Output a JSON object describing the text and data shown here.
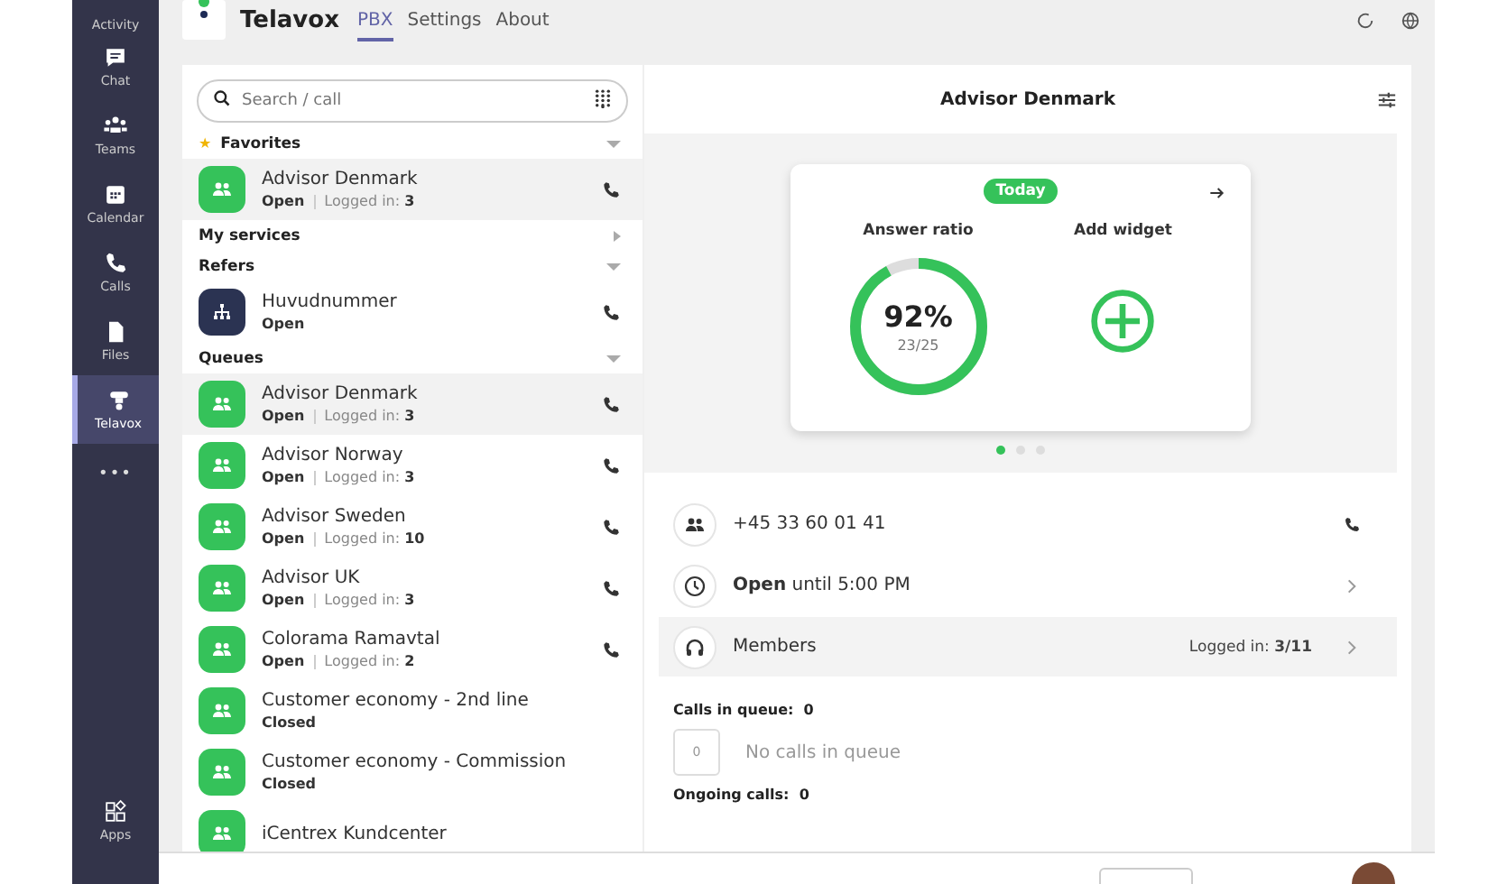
{
  "rail": {
    "items": [
      {
        "label": "Activity",
        "selected": false
      },
      {
        "label": "Chat",
        "selected": false
      },
      {
        "label": "Teams",
        "selected": false
      },
      {
        "label": "Calendar",
        "selected": false
      },
      {
        "label": "Calls",
        "selected": false
      },
      {
        "label": "Files",
        "selected": false
      },
      {
        "label": "Telavox",
        "selected": true
      }
    ],
    "more": "•••",
    "bottom": [
      {
        "label": "Apps"
      }
    ]
  },
  "header": {
    "app_name": "Telavox",
    "tabs": [
      {
        "label": "PBX",
        "selected": true
      },
      {
        "label": "Settings",
        "selected": false
      },
      {
        "label": "About",
        "selected": false
      }
    ]
  },
  "search": {
    "placeholder": "Search / call"
  },
  "sections": [
    {
      "title": "Favorites",
      "star": "★",
      "expanded": true,
      "items": [
        {
          "name": "Advisor Denmark",
          "kind": "queue",
          "status": "Open",
          "logged_label": "Logged in:",
          "logged": "3",
          "selected": true,
          "callable": true
        }
      ]
    },
    {
      "title": "My services",
      "expanded": false
    },
    {
      "title": "Refers",
      "expanded": true,
      "items": [
        {
          "name": "Huvudnummer",
          "kind": "refer",
          "status": "Open",
          "selected": false,
          "callable": true
        }
      ]
    },
    {
      "title": "Queues",
      "expanded": true,
      "items": [
        {
          "name": "Advisor Denmark",
          "kind": "queue",
          "status": "Open",
          "logged_label": "Logged in:",
          "logged": "3",
          "selected": true,
          "callable": true
        },
        {
          "name": "Advisor Norway",
          "kind": "queue",
          "status": "Open",
          "logged_label": "Logged in:",
          "logged": "3",
          "selected": false,
          "callable": true
        },
        {
          "name": "Advisor Sweden",
          "kind": "queue",
          "status": "Open",
          "logged_label": "Logged in:",
          "logged": "10",
          "selected": false,
          "callable": true
        },
        {
          "name": "Advisor UK",
          "kind": "queue",
          "status": "Open",
          "logged_label": "Logged in:",
          "logged": "3",
          "selected": false,
          "callable": true
        },
        {
          "name": "Colorama Ramavtal",
          "kind": "queue",
          "status": "Open",
          "logged_label": "Logged in:",
          "logged": "2",
          "selected": false,
          "callable": true
        },
        {
          "name": "Customer economy - 2nd line",
          "kind": "queue",
          "status": "Closed",
          "selected": false,
          "callable": false
        },
        {
          "name": "Customer economy - Commission",
          "kind": "queue",
          "status": "Closed",
          "selected": false,
          "callable": false
        },
        {
          "name": "iCentrex Kundcenter",
          "kind": "queue",
          "selected": false,
          "callable": false
        }
      ]
    }
  ],
  "detail": {
    "title": "Advisor Denmark",
    "widget": {
      "badge": "Today",
      "answer_title": "Answer ratio",
      "percent": "92%",
      "fraction": "23/25",
      "level": 0.92,
      "add_title": "Add widget"
    },
    "pager": [
      {
        "selected": true
      },
      {
        "selected": false
      },
      {
        "selected": false
      }
    ],
    "rows": [
      {
        "kind": "number",
        "text": "+45 33 60 01 41",
        "highlighted": false
      },
      {
        "kind": "hours",
        "text": "**Open** until 5:00 PM",
        "highlighted": false
      },
      {
        "kind": "members",
        "text": "Members",
        "meta": "Logged in: **3/11**",
        "highlighted": true
      }
    ],
    "calls_in_queue": "Calls in queue:  0",
    "queue_count": "0",
    "queue_empty": "No calls in queue",
    "ongoing": "Ongoing calls:  0"
  }
}
